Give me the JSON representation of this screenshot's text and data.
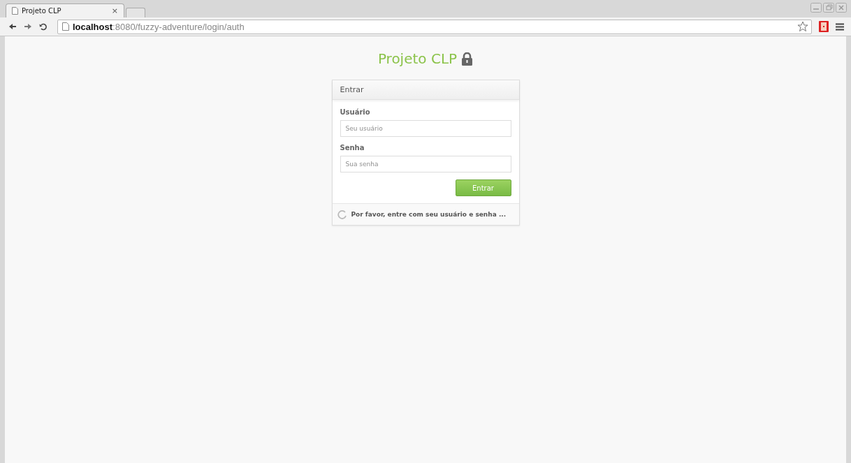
{
  "browser": {
    "tab_title": "Projeto CLP",
    "tab_close": "×",
    "address": "**localhost**:8080/fuzzy-adventure/login/auth"
  },
  "page": {
    "title": "Projeto CLP",
    "panel": {
      "heading": "Entrar",
      "fields": [
        {
          "label": "Usuário",
          "placeholder": "Seu usuário"
        },
        {
          "label": "Senha",
          "placeholder": "Sua senha"
        }
      ],
      "submit": "Entrar",
      "status": "Por favor, entre com seu usuário e senha ..."
    }
  }
}
